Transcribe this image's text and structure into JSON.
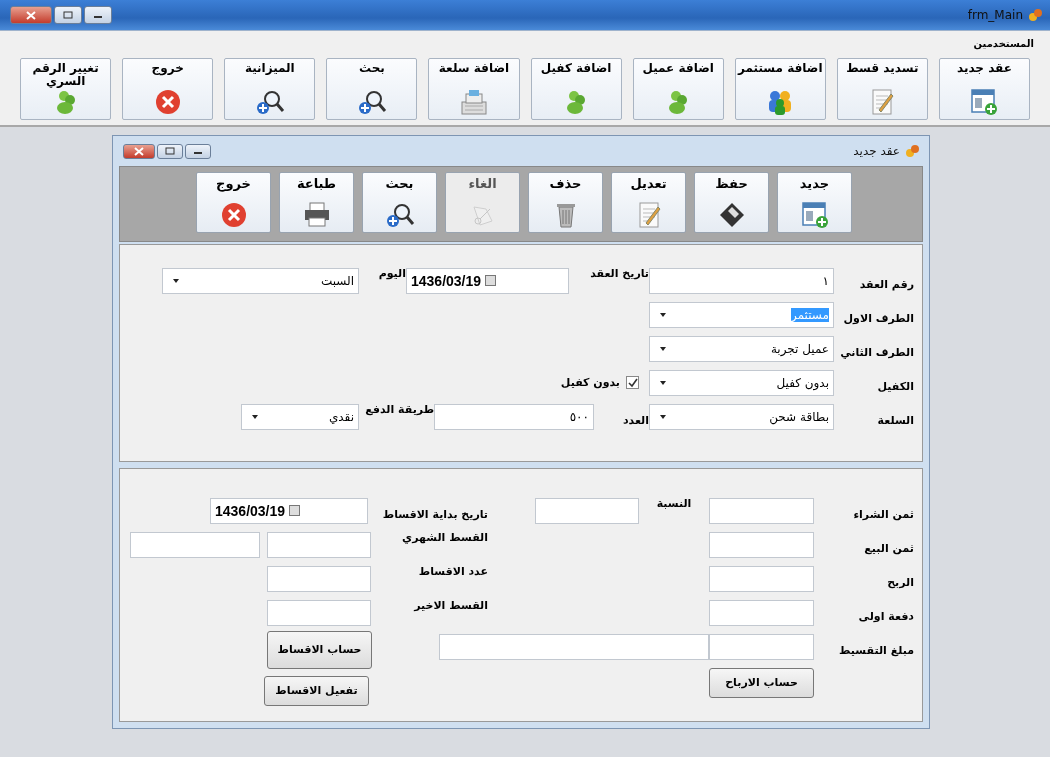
{
  "window": {
    "title": "frm_Main"
  },
  "menu": [
    {
      "label": "المستخدمين"
    }
  ],
  "toolbar": [
    {
      "label": "عقد جديد",
      "kind": "new"
    },
    {
      "label": "تسديد قسط",
      "kind": "notepad"
    },
    {
      "label": "اضافة مستثمر",
      "kind": "people"
    },
    {
      "label": "اضافة عميل",
      "kind": "group"
    },
    {
      "label": "اضافة كفيل",
      "kind": "group"
    },
    {
      "label": "اضافة سلعة",
      "kind": "register"
    },
    {
      "label": "بحث",
      "kind": "search"
    },
    {
      "label": "الميزانية",
      "kind": "search"
    },
    {
      "label": "خروج",
      "kind": "close"
    },
    {
      "label": "تغيير الرقم السري",
      "kind": "group"
    }
  ],
  "child_window": {
    "title": "عقد جديد",
    "toolbar": [
      {
        "label": "جديد",
        "kind": "new",
        "disabled": false
      },
      {
        "label": "حفظ",
        "kind": "save",
        "disabled": false
      },
      {
        "label": "تعديل",
        "kind": "notepad",
        "disabled": false
      },
      {
        "label": "حذف",
        "kind": "delete",
        "disabled": false
      },
      {
        "label": "الغاء",
        "kind": "cancel",
        "disabled": true
      },
      {
        "label": "بحث",
        "kind": "search",
        "disabled": false
      },
      {
        "label": "طباعة",
        "kind": "print",
        "disabled": false
      },
      {
        "label": "خروج",
        "kind": "close",
        "disabled": false
      }
    ]
  },
  "contract": {
    "contract_no": {
      "label": "رقم العقد",
      "value": "١"
    },
    "contract_date": {
      "label": "تاريخ العقد",
      "value": "1436/03/19"
    },
    "day": {
      "label": "اليوم",
      "value": "السبت"
    },
    "first_party": {
      "label": "الطرف الاول",
      "value": "مستثمر",
      "text_selected": true
    },
    "second_party": {
      "label": "الطرف الثاني",
      "value": "عميل تجربة"
    },
    "guarantor": {
      "label": "الكفيل",
      "value": "بدون كفيل"
    },
    "no_guarantor": {
      "label": "بدون كفيل",
      "checked": true
    },
    "item": {
      "label": "السلعة",
      "value": "بطاقة شحن"
    },
    "quantity": {
      "label": "العدد",
      "value": "٥٠٠"
    },
    "payment_method": {
      "label": "طريقة الدفع",
      "value": "نقدي"
    }
  },
  "installments": {
    "purchase_price": {
      "label": "ثمن الشراء"
    },
    "ratio": {
      "label": "النسبة"
    },
    "start_date": {
      "label": "تاريخ بداية الاقساط",
      "value": "1436/03/19"
    },
    "sale_price": {
      "label": "ثمن البيع"
    },
    "monthly": {
      "label": "القسط الشهري"
    },
    "profit": {
      "label": "الربح"
    },
    "count": {
      "label": "عدد الاقساط"
    },
    "down_payment": {
      "label": "دفعة اولى"
    },
    "last": {
      "label": "القسط الاخير"
    },
    "amount": {
      "label": "مبلغ التقسيط"
    },
    "calc_installments": {
      "label": "حساب الاقساط"
    },
    "calc_profits": {
      "label": "حساب الارباح"
    },
    "activate_installments": {
      "label": "تفعيل الاقساط"
    }
  }
}
